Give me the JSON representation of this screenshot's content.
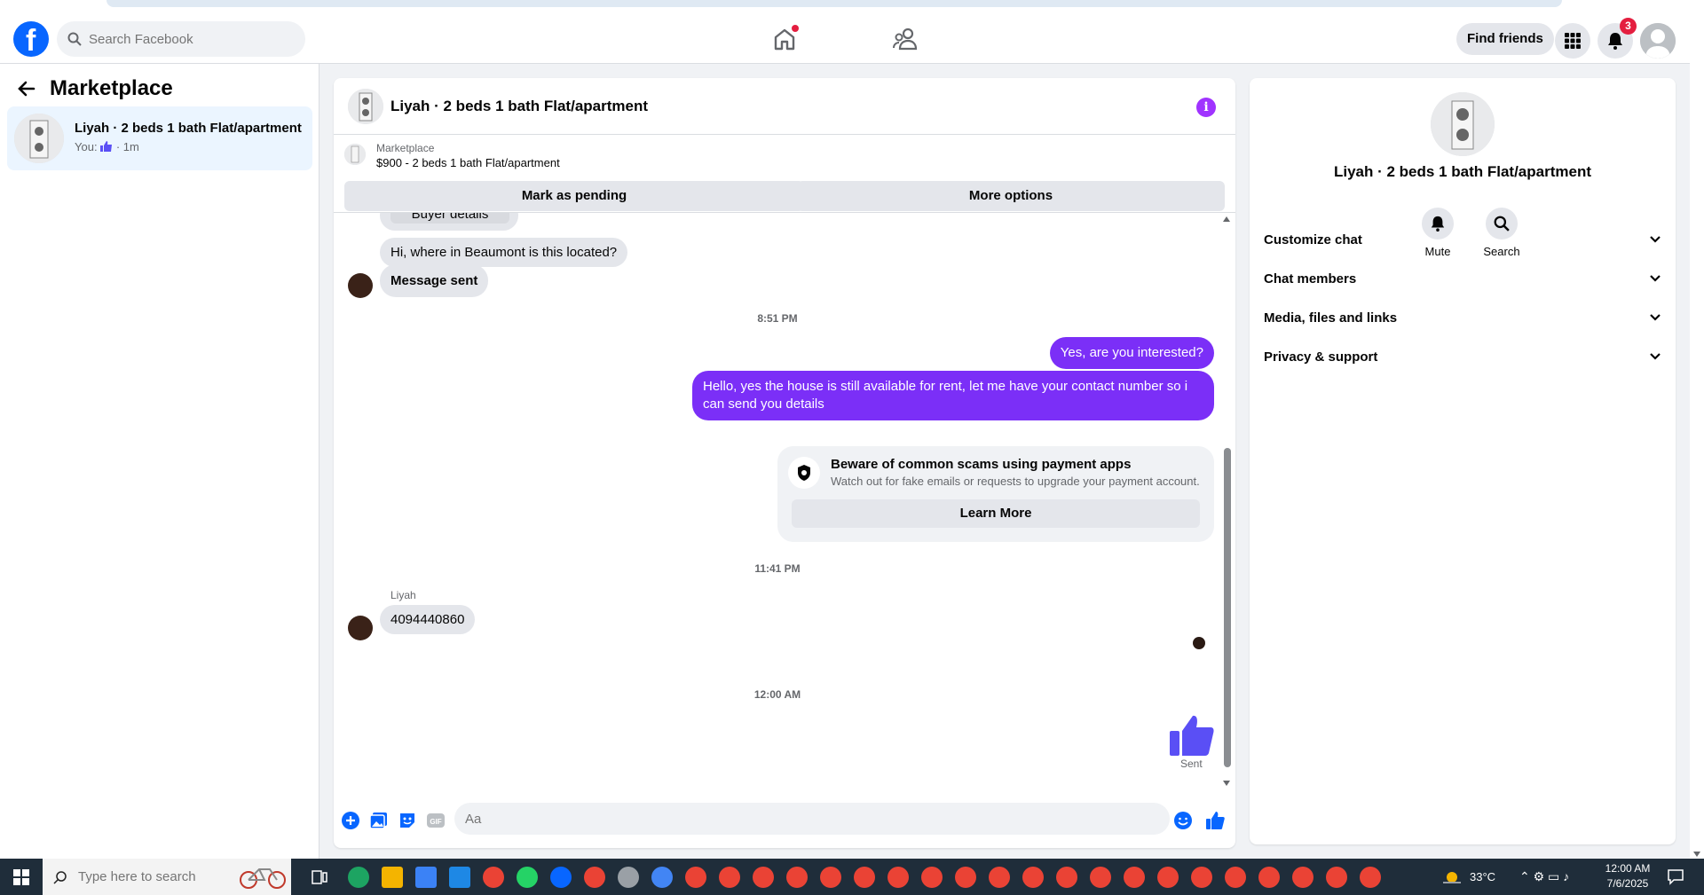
{
  "nav": {
    "search_placeholder": "Search Facebook",
    "find_friends": "Find friends",
    "notifications_count": "3"
  },
  "sidebar": {
    "title": "Marketplace",
    "conversation": {
      "title": "Liyah · 2 beds 1 bath Flat/apartment",
      "preview_prefix": "You:",
      "preview_suffix": "· 1m"
    }
  },
  "chat": {
    "header_title": "Liyah · 2 beds 1 bath Flat/apartment",
    "listing_caption": "Marketplace",
    "listing_title": "$900 - 2 beds 1 bath Flat/apartment",
    "mark_pending": "Mark as pending",
    "more_options": "More options",
    "messages": {
      "buyer_details": "Buyer details",
      "question": "Hi, where in Beaumont is this located?",
      "message_sent": "Message sent",
      "time1": "8:51 PM",
      "out1": "Yes, are you interested?",
      "out2": "Hello, yes the house is still available for rent, let me have your contact number so i can send you details",
      "scam_title": "Beware of common scams using payment apps",
      "scam_desc": "Watch out for fake emails or requests to upgrade your payment account.",
      "learn_more": "Learn More",
      "time2": "11:41 PM",
      "sender_name": "Liyah",
      "phone": "4094440860",
      "time3": "12:00 AM",
      "sent_status": "Sent"
    },
    "composer_placeholder": "Aa"
  },
  "details": {
    "name": "Liyah · 2 beds 1 bath Flat/apartment",
    "mute": "Mute",
    "search": "Search",
    "sections": [
      "Customize chat",
      "Chat members",
      "Media, files and links",
      "Privacy & support"
    ]
  },
  "taskbar": {
    "search_placeholder": "Type here to search",
    "temperature": "33°C",
    "time": "12:00 AM",
    "date": "7/6/2025"
  },
  "colors": {
    "brand": "#0866ff",
    "outgoing_bubble": "#7b2ff7",
    "like": "#5a4ff5"
  }
}
